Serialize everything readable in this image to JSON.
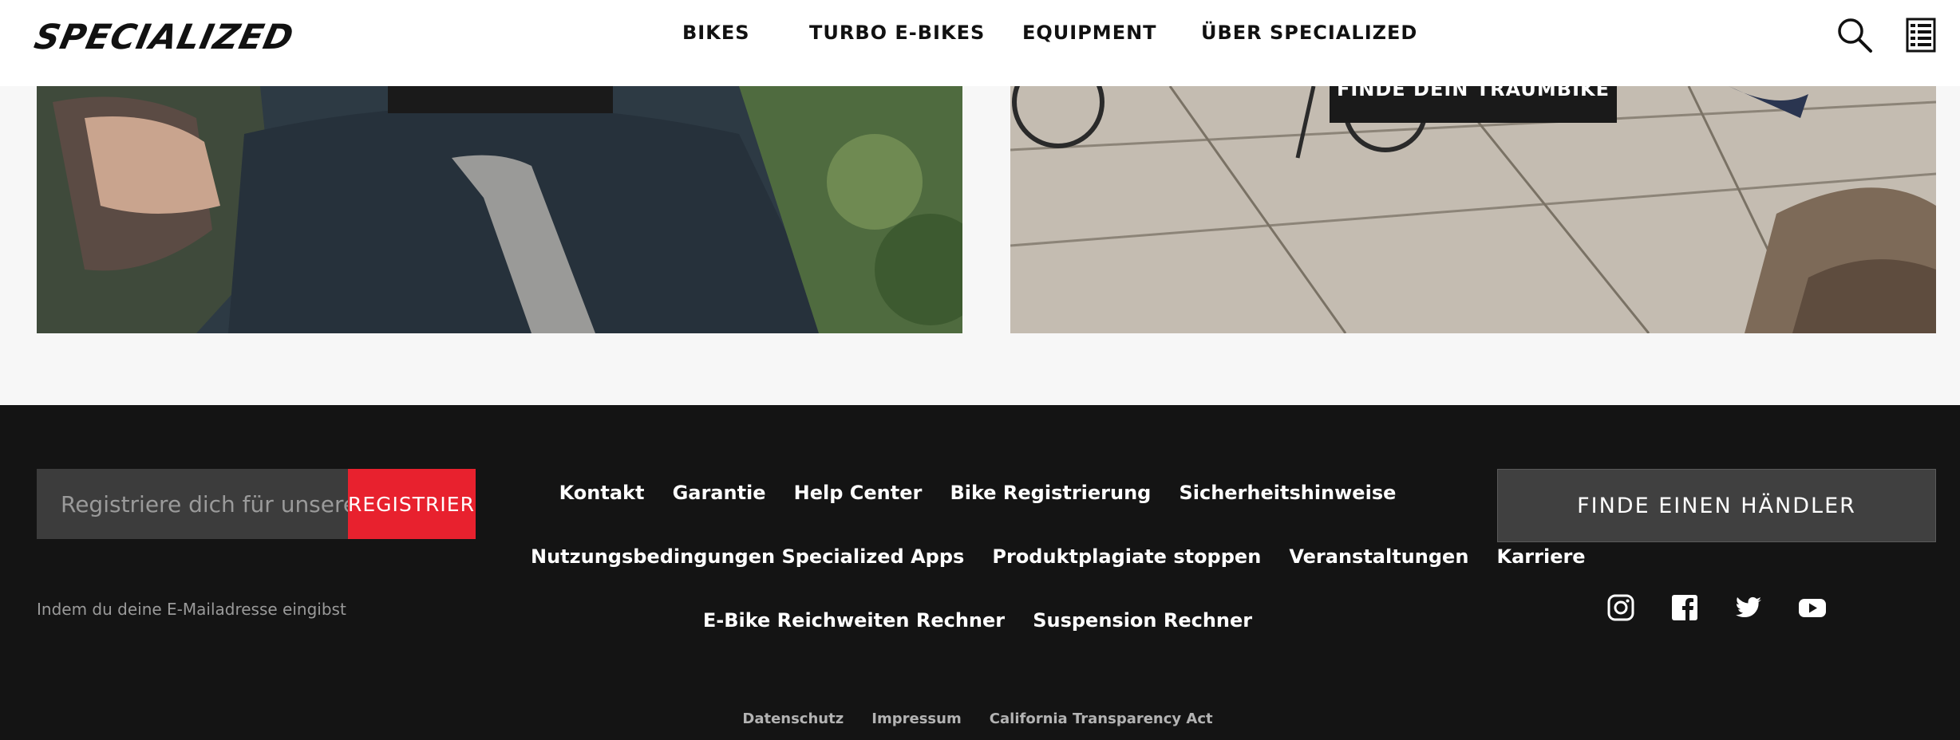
{
  "header": {
    "logo_text": "SPECIALIZED",
    "nav": [
      "BIKES",
      "TURBO E-BIKES",
      "EQUIPMENT",
      "ÜBER SPECIALIZED"
    ],
    "icons": [
      "search-icon",
      "menu-list-icon"
    ]
  },
  "tiles": {
    "right_cta": "FINDE DEIN TRAUMBIKE"
  },
  "footer": {
    "newsletter": {
      "placeholder": "Registriere dich für unsere",
      "button_label": "REGISTRIEREN",
      "note": "Indem du deine E-Mailadresse eingibst",
      "button_color": "#e8212e"
    },
    "links_row1": [
      "Kontakt",
      "Garantie",
      "Help Center",
      "Bike Registrierung",
      "Sicherheitshinweise"
    ],
    "links_row2": [
      "Nutzungsbedingungen Specialized Apps",
      "Produktplagiate stoppen",
      "Veranstaltungen",
      "Karriere"
    ],
    "links_row3": [
      "E-Bike Reichweiten Rechner",
      "Suspension Rechner"
    ],
    "legal": [
      "Datenschutz",
      "Impressum",
      "California Transparency Act"
    ],
    "dealer_button": "FINDE EINEN HÄNDLER",
    "social": [
      "instagram-icon",
      "facebook-icon",
      "twitter-icon",
      "youtube-icon"
    ]
  }
}
